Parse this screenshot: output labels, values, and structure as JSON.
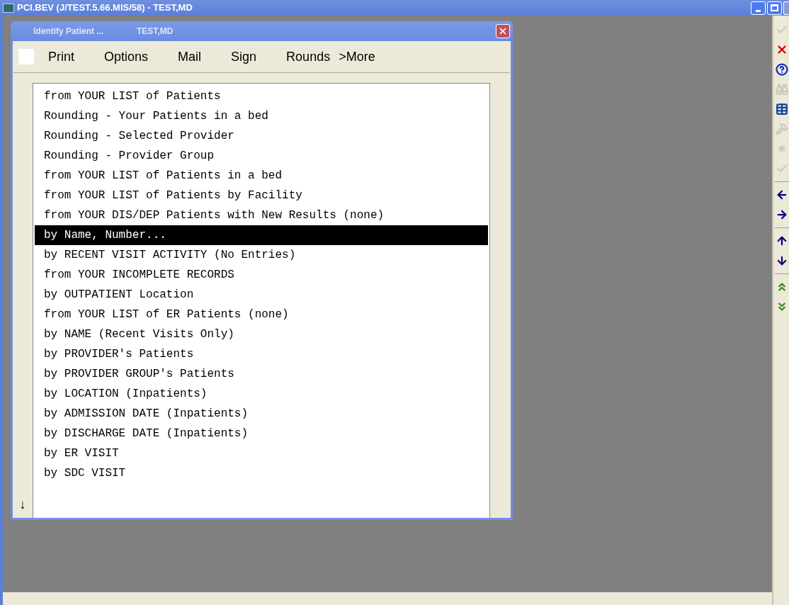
{
  "window": {
    "title": "PCI.BEV (J/TEST.5.66.MIS/58) - TEST,MD"
  },
  "dialog": {
    "title": "Identify Patient ...",
    "user": "TEST,MD",
    "menu_checkbox": {
      "checked": false
    },
    "menu": [
      "Print",
      "Options",
      "Mail",
      "Sign",
      "Rounds",
      ">More"
    ],
    "list": {
      "scroll_marker": "↓",
      "items": [
        {
          "label": "from YOUR LIST of Patients",
          "selected": false
        },
        {
          "label": "Rounding - Your Patients in a bed",
          "selected": false
        },
        {
          "label": "Rounding - Selected Provider",
          "selected": false
        },
        {
          "label": "Rounding - Provider Group",
          "selected": false
        },
        {
          "label": "from YOUR LIST of Patients in a bed",
          "selected": false
        },
        {
          "label": "from YOUR LIST of Patients by Facility",
          "selected": false
        },
        {
          "label": "from YOUR DIS/DEP Patients with New Results (none)",
          "selected": false
        },
        {
          "label": "by Name, Number...",
          "selected": true
        },
        {
          "label": "by RECENT VISIT ACTIVITY (No Entries)",
          "selected": false
        },
        {
          "label": "from YOUR INCOMPLETE RECORDS",
          "selected": false
        },
        {
          "label": "by OUTPATIENT Location",
          "selected": false
        },
        {
          "label": "from YOUR LIST of ER Patients (none)",
          "selected": false
        },
        {
          "label": "by NAME (Recent Visits Only)",
          "selected": false
        },
        {
          "label": "by PROVIDER's Patients",
          "selected": false
        },
        {
          "label": "by PROVIDER GROUP's Patients",
          "selected": false
        },
        {
          "label": "by LOCATION (Inpatients)",
          "selected": false
        },
        {
          "label": "by ADMISSION DATE (Inpatients)",
          "selected": false
        },
        {
          "label": "by DISCHARGE DATE (Inpatients)",
          "selected": false
        },
        {
          "label": "by ER VISIT",
          "selected": false
        },
        {
          "label": "by SDC VISIT",
          "selected": false
        }
      ]
    }
  },
  "toolbar": [
    {
      "kind": "check",
      "disabled": true
    },
    {
      "kind": "cancel",
      "disabled": false
    },
    {
      "kind": "help",
      "disabled": false
    },
    {
      "kind": "binoculars",
      "disabled": true
    },
    {
      "kind": "grid",
      "disabled": false
    },
    {
      "kind": "hammer",
      "disabled": true
    },
    {
      "kind": "asterisk",
      "disabled": true
    },
    {
      "kind": "check",
      "disabled": true
    },
    {
      "kind": "separator"
    },
    {
      "kind": "left",
      "disabled": false
    },
    {
      "kind": "right",
      "disabled": false
    },
    {
      "kind": "separator"
    },
    {
      "kind": "up",
      "disabled": false
    },
    {
      "kind": "down",
      "disabled": false
    },
    {
      "kind": "separator"
    },
    {
      "kind": "page-up",
      "disabled": false
    },
    {
      "kind": "page-down",
      "disabled": false
    }
  ]
}
